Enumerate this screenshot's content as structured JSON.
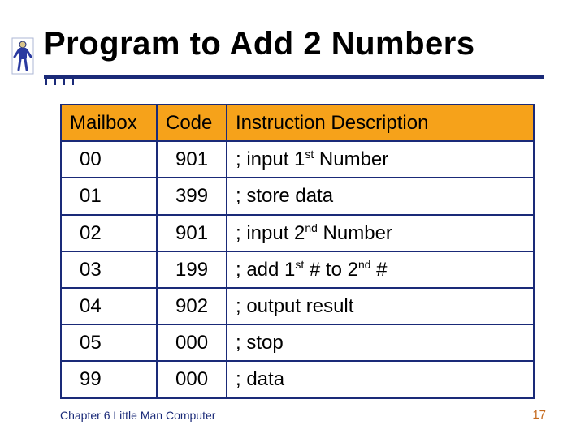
{
  "slide": {
    "title": "Program to Add 2 Numbers",
    "icon_name": "little-man-computer-character"
  },
  "table": {
    "headers": {
      "mailbox": "Mailbox",
      "code": "Code",
      "desc": "Instruction Description"
    },
    "rows": [
      {
        "mailbox": "00",
        "code": "901",
        "desc_html": "; input 1<sup>st</sup> Number"
      },
      {
        "mailbox": "01",
        "code": "399",
        "desc_html": "; store data"
      },
      {
        "mailbox": "02",
        "code": "901",
        "desc_html": "; input 2<sup>nd</sup> Number"
      },
      {
        "mailbox": "03",
        "code": "199",
        "desc_html": "; add 1<sup>st</sup> # to 2<sup>nd</sup> #"
      },
      {
        "mailbox": "04",
        "code": "902",
        "desc_html": "; output result"
      },
      {
        "mailbox": "05",
        "code": "000",
        "desc_html": "; stop"
      },
      {
        "mailbox": "99",
        "code": "000",
        "desc_html": "; data"
      }
    ]
  },
  "footer": {
    "chapter": "Chapter 6 Little Man Computer",
    "page": "17"
  },
  "colors": {
    "accent_blue": "#1a2a78",
    "header_orange": "#f6a21a",
    "page_orange": "#c56a1e"
  }
}
